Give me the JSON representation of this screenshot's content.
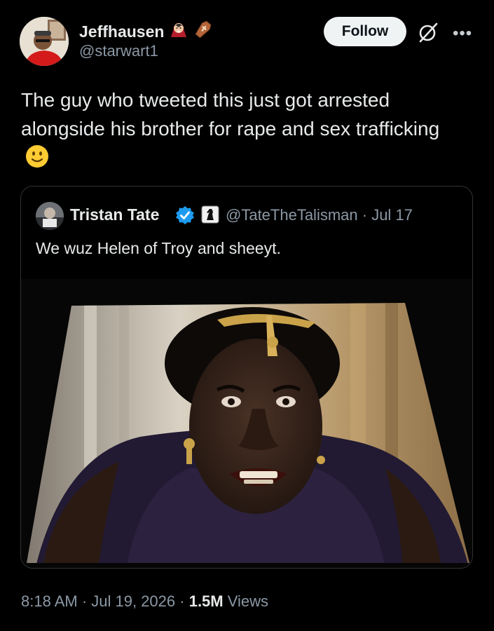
{
  "tweet": {
    "author": {
      "display_name": "Jeffhausen",
      "handle": "@starwart1",
      "name_emojis": [
        "vampire-emoji",
        "coffin-emoji"
      ]
    },
    "follow_label": "Follow",
    "grok_icon": "grok-icon",
    "more_icon": "more-dots-icon",
    "text": "The guy who tweeted this just got arrested alongside his brother for rape and sex trafficking",
    "text_emoji": "slightly-smiling-face-emoji",
    "timestamp": "8:18 AM · Jul 19, 2026 · ",
    "views_count": "1.5M",
    "views_label": " Views"
  },
  "quote": {
    "display_name": "Tristan Tate",
    "verified_icon": "verified-badge-icon",
    "affiliation_icon": "chess-knight-affiliation-icon",
    "handle": "@TateTheTalisman",
    "date": " · Jul 17",
    "text": "We wuz Helen of Troy and sheeyt.",
    "media": "photo-angry-woman-gold-headpiece"
  },
  "colors": {
    "background": "#000000",
    "text_primary": "#e7e9ea",
    "text_secondary": "#8b98a5",
    "follow_bg": "#eff3f4",
    "verified_blue": "#1d9bf0",
    "border": "#2f3336"
  }
}
